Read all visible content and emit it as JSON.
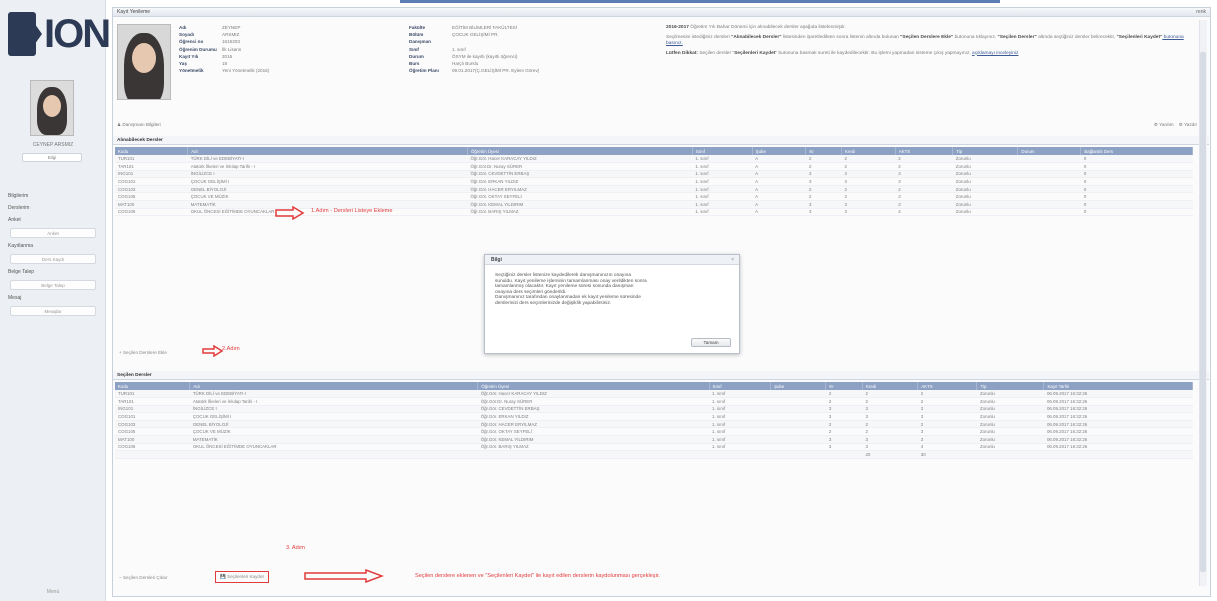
{
  "sidebar": {
    "logo_text": "ION",
    "student_name": "CEYNEP ARSMIZ",
    "profile_button": "Bilgi",
    "menu": [
      {
        "label": "Bilgilerim",
        "sub": null
      },
      {
        "label": "Derslerim",
        "sub": null
      },
      {
        "label": "Anket",
        "sub": "Anket"
      },
      {
        "label": "Kayıtlanma",
        "sub": "Ders Kaydı"
      },
      {
        "label": "Belge Talep",
        "sub": "Belge Talep"
      },
      {
        "label": "Mesaj",
        "sub": "Mesajlar"
      }
    ],
    "bottom_label": "Menü"
  },
  "window": {
    "title": "Kayıt Yenileme",
    "right_label": "renk"
  },
  "student": {
    "col1": [
      {
        "k": "Adı",
        "v": "ZEYNEP"
      },
      {
        "k": "Soyadı",
        "v": "ARSMIZ"
      },
      {
        "k": "Öğrenci no",
        "v": "1615203"
      },
      {
        "k": "Öğrenim Durumu",
        "v": "İlk Lisans"
      },
      {
        "k": "Kayıt Yılı",
        "v": "2016"
      },
      {
        "k": "Yaş",
        "v": "18"
      },
      {
        "k": "Yönetmelik",
        "v": "Yeni Yönetmelik (2016)"
      }
    ],
    "col2": [
      {
        "k": "Fakülte",
        "v": "EĞİTİM BİLİMLERİ FAKÜLTESİ"
      },
      {
        "k": "Bölüm",
        "v": "ÇOCUK GELİŞİMİ PR."
      },
      {
        "k": "Danışman",
        "v": ""
      },
      {
        "k": "Sınıf",
        "v": "1. sınıf"
      },
      {
        "k": "Durum",
        "v": "ÖSYM ile kayıtlı (kayıtlı öğrenci)"
      },
      {
        "k": "Burs",
        "v": "Harçlı Burslu"
      },
      {
        "k": "Öğretim Planı",
        "v": "09.01.2017(Ç.GELİŞİMİ PR. Eylem Görev)"
      }
    ]
  },
  "notice": {
    "p1_bold": "2016-2017",
    "p1": " Öğretim Yılı Bahar Dönemi için alınabilecek dersler aşağıda listelenmiştir.",
    "p2_pre": "Seçilmesini istediğiniz dersleri ",
    "p2_bold1": "\"Alınabilecek Dersler\"",
    "p2_mid": " listesinden işaretledikten sonra listenin altında bulunan ",
    "p2_bold2": "\"Seçilen Derslere Ekle\"",
    "p2_mid2": " butonuna tıklayınız. ",
    "p2_bold3": "\"Seçilen Dersler\"",
    "p2_mid3": " altında seçtiğiniz dersler belirecektir, ",
    "p2_bold4": "\"Seçilenleri Kaydet\"",
    "p2_link": " butonuna basınız.",
    "p3_bold": "Lütfen Dikkat:",
    "p3": " Seçilen dersler \"",
    "p3_bold2": "Seçilenleri Kaydet",
    "p3_end": "\" butonuna basmak sureti ile kaydedilecektir. Bu işlemi yapmadan sisteme çıkış yapmayınız, ",
    "p3_link": "açıklamayı inceleyiniz"
  },
  "toolbar": {
    "left": "Danışmanı Bilgileri",
    "right1": "Yardım",
    "right2": "Yazdır"
  },
  "available": {
    "title": "Alınabilecek Dersler",
    "columns": [
      "Kodu",
      "Adı",
      "Öğretim Üyesi",
      "Sınıf",
      "Şube",
      "Kr",
      "Kredi",
      "AKTS",
      "Tip",
      "Durum",
      "Bağlantılı Ders"
    ],
    "rows": [
      [
        "TUR101",
        "TÜRK DİLİ ve EDEBİYATI-I",
        "Öğr.Gör. Hacer KARACAY YILDIZ",
        "1. sınıf",
        "A",
        "2",
        "2",
        "2",
        "Zorunlu",
        "",
        "0"
      ],
      [
        "TAR101",
        "Atatürk İlkeleri ve İnkılap Tarihi - I",
        "Öğr.Gör.Dr. Nuray SÜRER",
        "1. sınıf",
        "A",
        "2",
        "2",
        "2",
        "Zorunlu",
        "",
        "0"
      ],
      [
        "ING101",
        "İNGİLİZCE I",
        "Öğr.Gör. CEVDETTİN ERBAŞ",
        "1. sınıf",
        "A",
        "3",
        "3",
        "3",
        "Zorunlu",
        "",
        "0"
      ],
      [
        "COG101",
        "ÇOCUK GELİŞİMİ I",
        "Öğr.Gör. ERKAN YILDIZ",
        "1. sınıf",
        "A",
        "3",
        "3",
        "3",
        "Zorunlu",
        "",
        "0"
      ],
      [
        "COG103",
        "GENEL BİYOLOJİ",
        "Öğr.Gör. HACER ERYILMAZ",
        "1. sınıf",
        "A",
        "2",
        "2",
        "2",
        "Zorunlu",
        "",
        "0"
      ],
      [
        "COG105",
        "ÇOCUK VE MÜZİK",
        "Öğr.Gör. OKTAY SEYFELİ",
        "1. sınıf",
        "A",
        "2",
        "2",
        "3",
        "Zorunlu",
        "",
        "0"
      ],
      [
        "MAT100",
        "MATEMATİK",
        "Öğr.Gör. KEMAL YILDIRIM",
        "1. sınıf",
        "A",
        "3",
        "3",
        "3",
        "Zorunlu",
        "",
        "0"
      ],
      [
        "COG106",
        "OKUL ÖNCESİ EĞİTİMDE OYUNCAKLAR",
        "Öğr.Gör. BARIŞ YILMAZ",
        "1. sınıf",
        "A",
        "3",
        "3",
        "4",
        "Zorunlu",
        "",
        "0"
      ]
    ],
    "add_button": "Seçilen Derslere Ekle"
  },
  "selected": {
    "title": "Seçilen Dersler",
    "columns": [
      "Kodu",
      "Adı",
      "Öğretim Üyesi",
      "Sınıf",
      "Şube",
      "Kr",
      "Kredi",
      "AKTS",
      "Tip",
      "Kayıt Tarihi"
    ],
    "rows": [
      [
        "TUR101",
        "TÜRK DİLİ ve EDEBİYATI-I",
        "Öğr.Gör. Hacer KARACAY YILDIZ",
        "1. sınıf",
        "",
        "2",
        "2",
        "2",
        "Zorunlu",
        "06.09.2017 16:32:26"
      ],
      [
        "TAR101",
        "Atatürk İlkeleri ve İnkılap Tarihi - I",
        "Öğr.Gör.Dr. Nuray SÜRER",
        "1. sınıf",
        "",
        "2",
        "2",
        "2",
        "Zorunlu",
        "06.09.2017 16:32:26"
      ],
      [
        "ING101",
        "İNGİLİZCE I",
        "Öğr.Gör. CEVDETTİN ERBAŞ",
        "1. sınıf",
        "",
        "3",
        "3",
        "3",
        "Zorunlu",
        "06.09.2017 16:32:26"
      ],
      [
        "COG101",
        "ÇOCUK GELİŞİMİ I",
        "Öğr.Gör. ERKAN YILDIZ",
        "1. sınıf",
        "",
        "3",
        "3",
        "3",
        "Zorunlu",
        "06.09.2017 16:32:26"
      ],
      [
        "COG103",
        "GENEL BİYOLOJİ",
        "Öğr.Gör. HACER ERYILMAZ",
        "1. sınıf",
        "",
        "2",
        "2",
        "2",
        "Zorunlu",
        "06.09.2017 16:32:26"
      ],
      [
        "COG105",
        "ÇOCUK VE MÜZİK",
        "Öğr.Gör. OKTAY SEYFELİ",
        "1. sınıf",
        "",
        "2",
        "2",
        "3",
        "Zorunlu",
        "06.09.2017 16:32:26"
      ],
      [
        "MAT100",
        "MATEMATİK",
        "Öğr.Gör. KEMAL YILDIRIM",
        "1. sınıf",
        "",
        "3",
        "3",
        "3",
        "Zorunlu",
        "06.09.2017 16:32:26"
      ],
      [
        "COG106",
        "OKUL ÖNCESİ EĞİTİMDE OYUNCAKLAR",
        "Öğr.Gör. BARIŞ YILMAZ",
        "1. sınıf",
        "",
        "3",
        "3",
        "4",
        "Zorunlu",
        "06.09.2017 16:32:26"
      ]
    ],
    "totals": {
      "kredi": "20",
      "akts": "30"
    },
    "remove_button": "Seçilen Dersleri Çıkar",
    "save_button": "Seçilenleri Kaydet"
  },
  "dialog": {
    "title": "Bilgi",
    "close": "×",
    "lines": [
      "Seçtiğiniz dersler listenize kaydedilerek danışmanınızın onayına",
      "sunuldu. Kayıt yenileme işleminin tamamlanması onay verildikten sonra",
      "tamamlanmış olacaktır. Kayıt yenileme süresi sonunda danışman",
      "onayına ders seçimleri gönderildi.",
      "Danışmanınız tarafından onaylanmadan ek kayıt yenileme süresinde",
      "derslerinizi ders seçimlerinizde değişiklik yapabilirsiniz."
    ],
    "ok_button": "Tamam"
  },
  "annotations": {
    "step1": "1.Adım - Dersleri Listeye Ekleme",
    "step2": "2.Adım",
    "step3": "3. Adım",
    "step3_desc": "Seçilen derslere eklenen ve \"Seçilenleri Kaydet\" ile kayıt edilen derslerin kaydolunması gerçekleşir.",
    "color": "#e23b3b"
  }
}
